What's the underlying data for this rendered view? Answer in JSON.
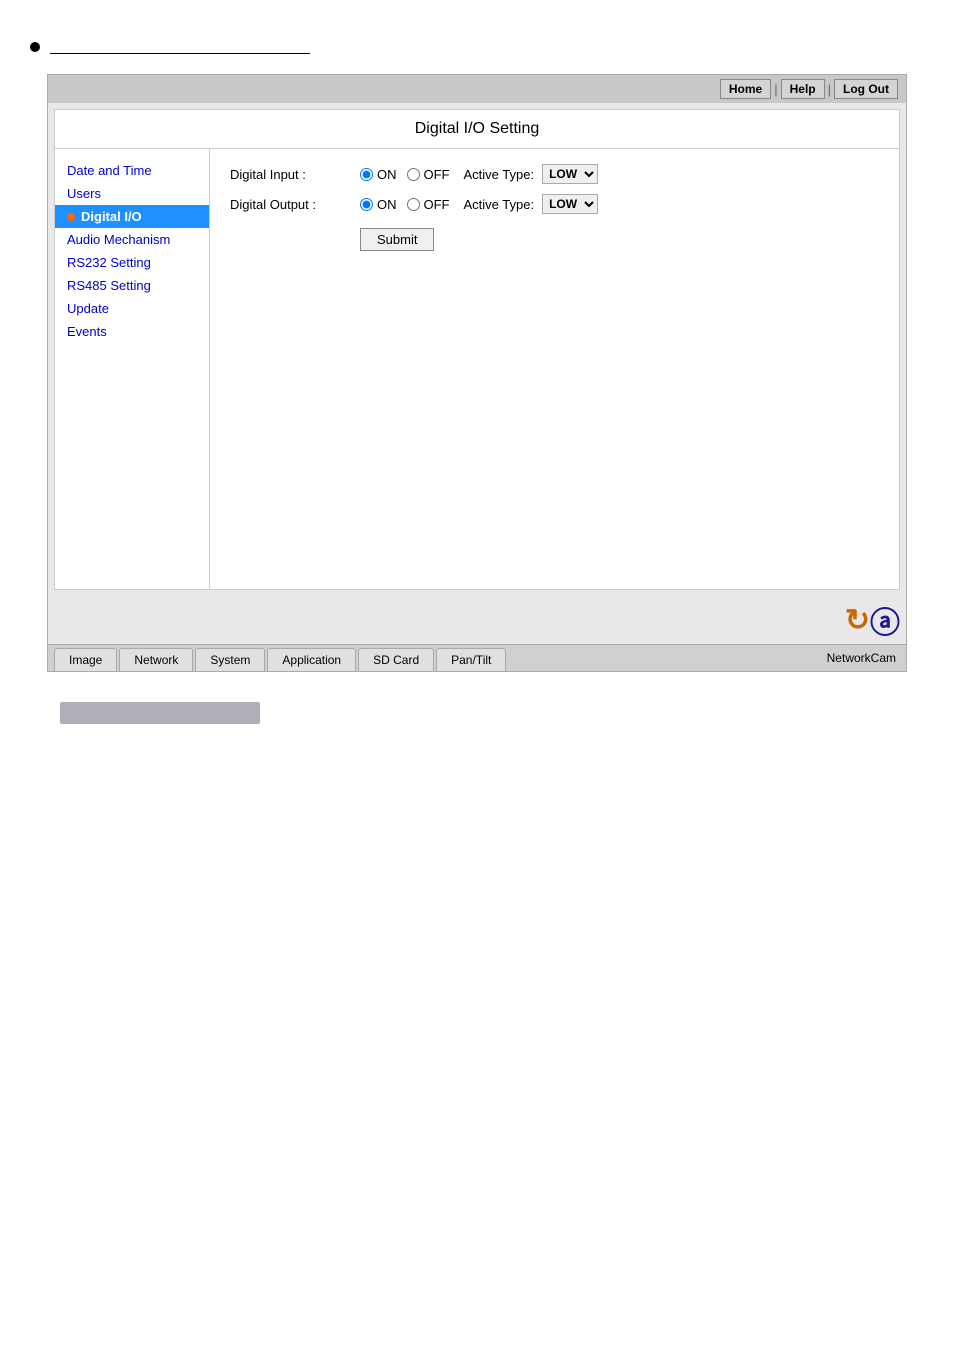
{
  "page": {
    "bullet_underline": "",
    "main_title": "Digital I/O Setting"
  },
  "topbar": {
    "home_label": "Home",
    "help_label": "Help",
    "logout_label": "Log Out"
  },
  "sidebar": {
    "items": [
      {
        "id": "date-time",
        "label": "Date and Time",
        "active": false,
        "dot": false
      },
      {
        "id": "users",
        "label": "Users",
        "active": false,
        "dot": false
      },
      {
        "id": "digital-io",
        "label": "Digital I/O",
        "active": true,
        "dot": true
      },
      {
        "id": "audio-mechanism",
        "label": "Audio Mechanism",
        "active": false,
        "dot": false
      },
      {
        "id": "rs232-setting",
        "label": "RS232 Setting",
        "active": false,
        "dot": false
      },
      {
        "id": "rs485-setting",
        "label": "RS485 Setting",
        "active": false,
        "dot": false
      },
      {
        "id": "update",
        "label": "Update",
        "active": false,
        "dot": false
      },
      {
        "id": "events",
        "label": "Events",
        "active": false,
        "dot": false
      }
    ]
  },
  "settings": {
    "digital_input_label": "Digital Input :",
    "digital_output_label": "Digital Output :",
    "on_label": "ON",
    "off_label": "OFF",
    "active_type_label": "Active Type:",
    "low_option": "LOW",
    "submit_label": "Submit",
    "input_selected": "on",
    "output_selected": "on"
  },
  "bottom_tabs": {
    "tabs": [
      {
        "id": "image",
        "label": "Image"
      },
      {
        "id": "network",
        "label": "Network"
      },
      {
        "id": "system",
        "label": "System"
      },
      {
        "id": "application",
        "label": "Application"
      },
      {
        "id": "sd-card",
        "label": "SD Card"
      },
      {
        "id": "pan-tilt",
        "label": "Pan/Tilt"
      }
    ]
  },
  "brand": {
    "name": "NetworkCam"
  }
}
